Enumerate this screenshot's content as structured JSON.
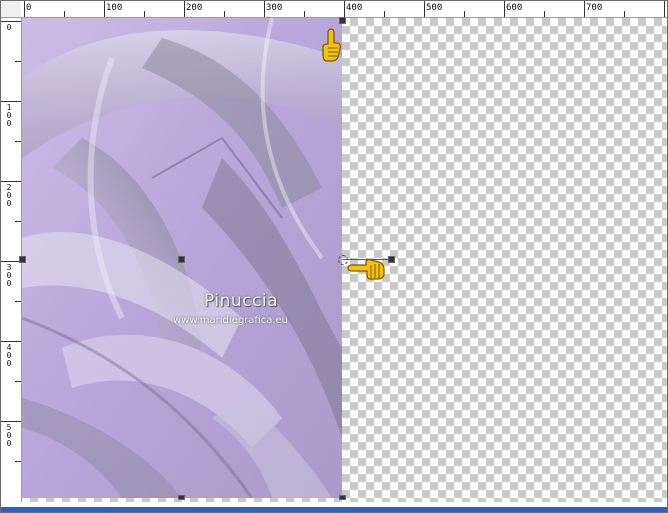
{
  "ruler": {
    "top_labels": [
      "0",
      "100",
      "200",
      "300",
      "400",
      "500",
      "600",
      "700"
    ],
    "left_labels": [
      "0",
      "100",
      "200",
      "300",
      "400",
      "500"
    ]
  },
  "watermark": {
    "name": "Pinuccia",
    "url": "www.maridiegrafica.eu"
  },
  "colors": {
    "image_base": "#b8a8d8",
    "selection_bar": "#2c61c9",
    "checker": "#c9c9c9"
  },
  "icons": {
    "top_right_hand": "pointing-up-hand-icon",
    "middle_hand": "pointing-left-hand-icon"
  }
}
